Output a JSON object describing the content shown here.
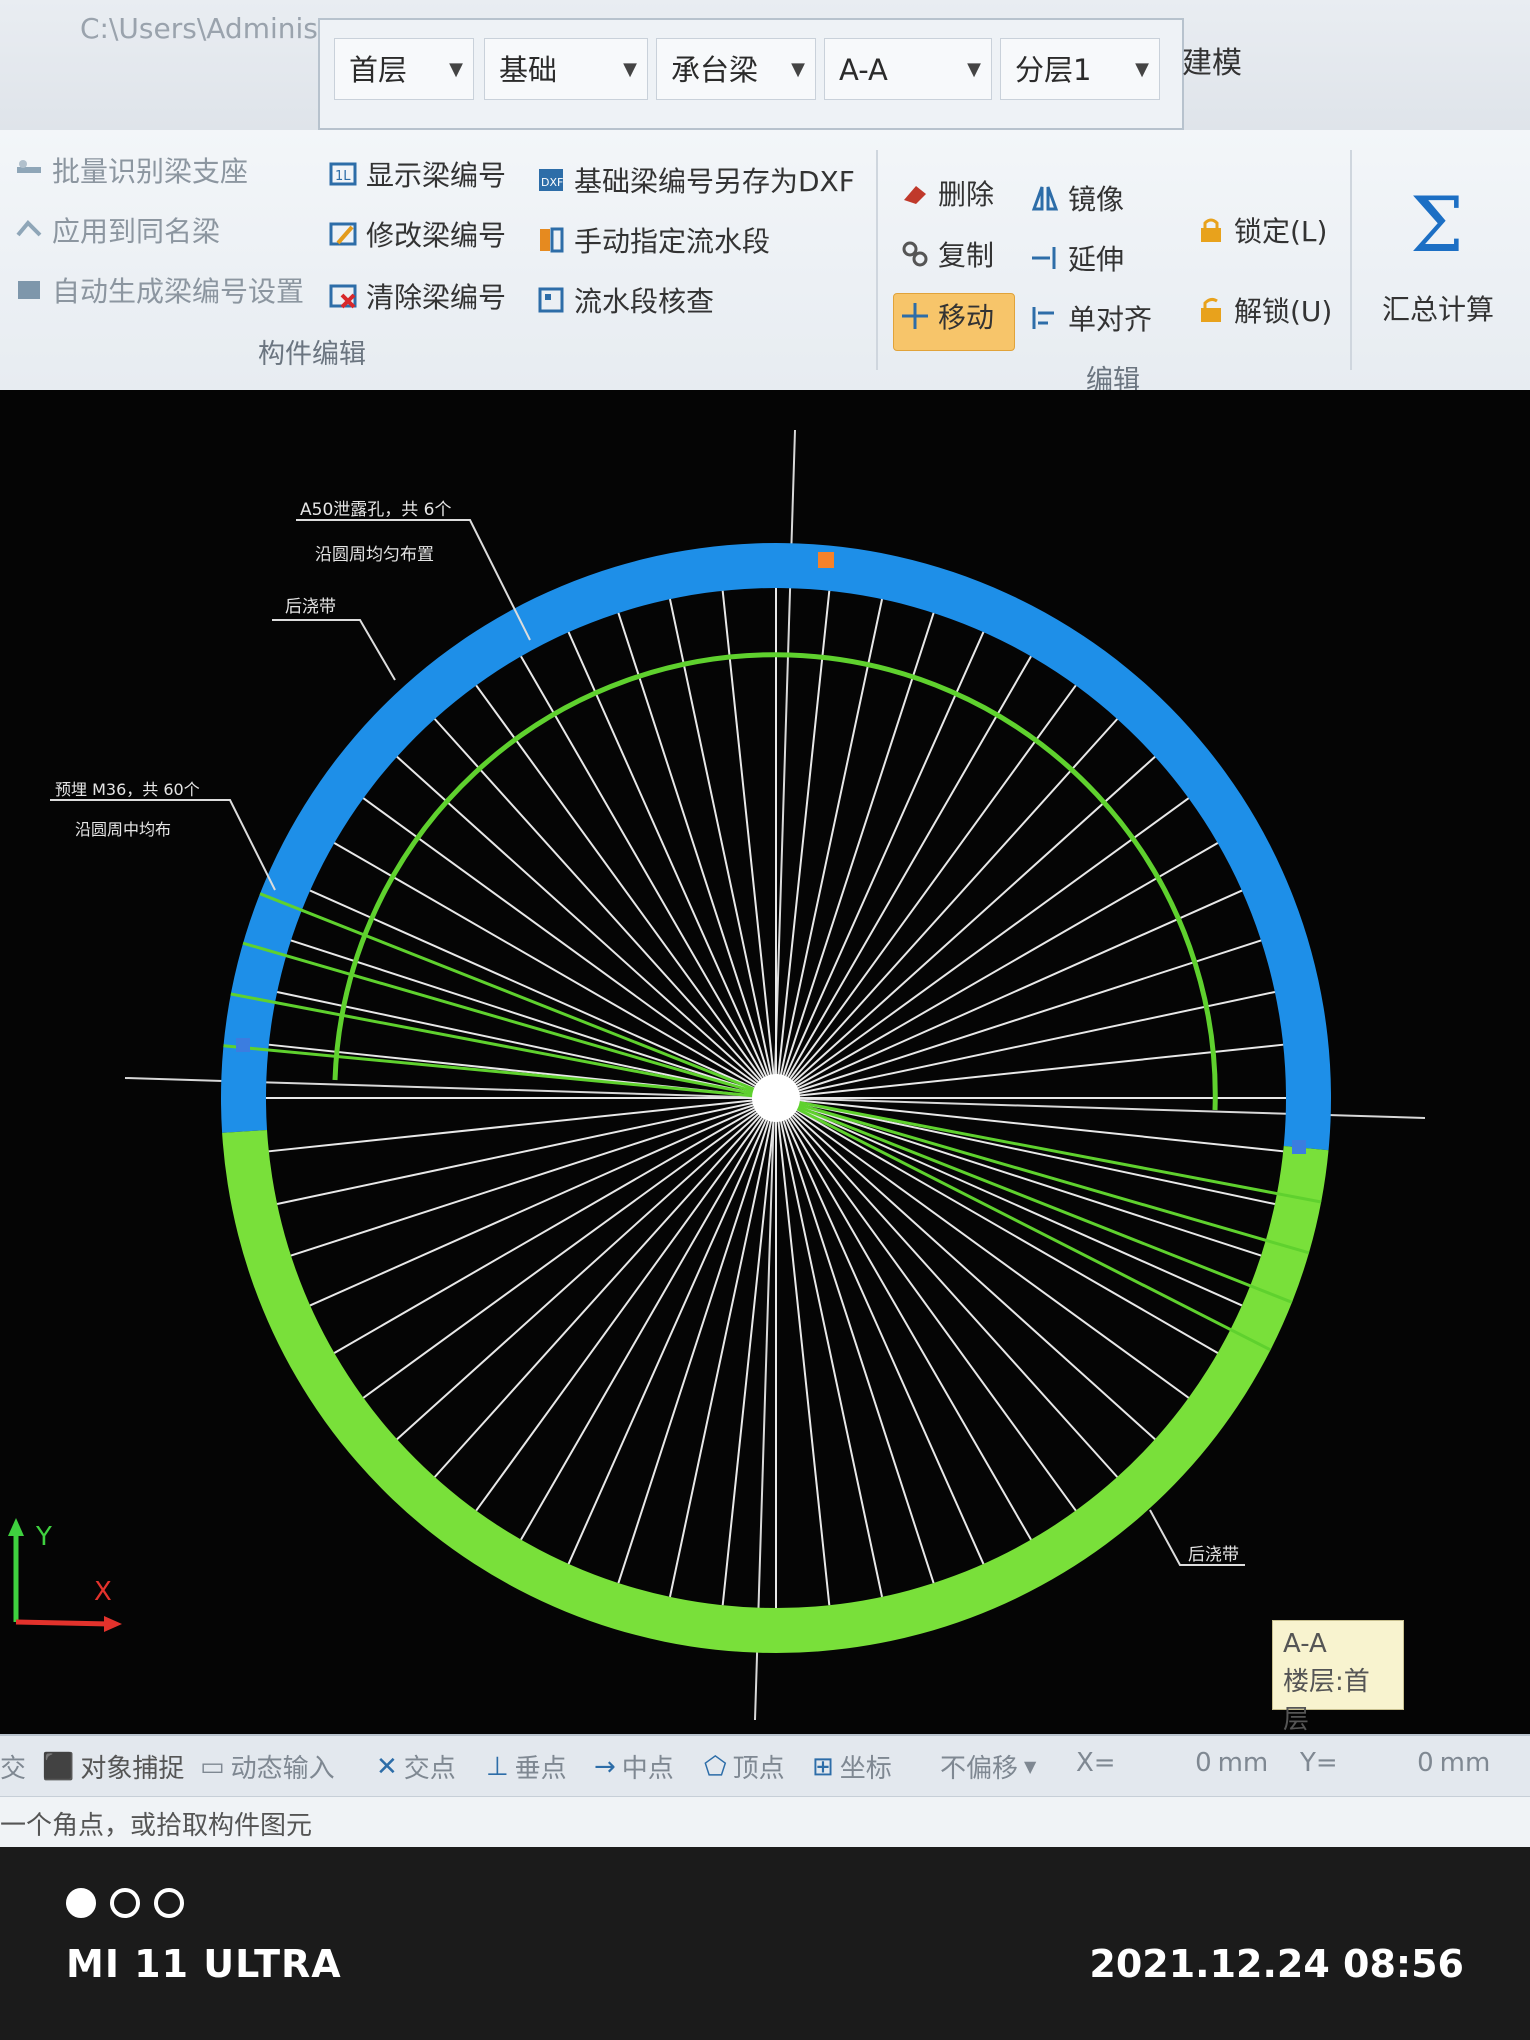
{
  "window": {
    "path": "C:\\Users\\Administ"
  },
  "selectors": [
    {
      "label": "首层"
    },
    {
      "label": "基础"
    },
    {
      "label": "承台梁"
    },
    {
      "label": "A-A"
    },
    {
      "label": "分层1"
    }
  ],
  "build_label": "建模",
  "ribbon": {
    "component_edit": {
      "group_label": "构件编辑",
      "items": [
        "批量识别梁支座",
        "应用到同名梁",
        "自动生成梁编号设置"
      ]
    },
    "beam_numbering": {
      "items": [
        "显示梁编号",
        "修改梁编号",
        "清除梁编号"
      ]
    },
    "flow": {
      "items": [
        "基础梁编号另存为DXF",
        "手动指定流水段",
        "流水段核查"
      ]
    },
    "edit": {
      "group_label": "编辑",
      "items": [
        "删除",
        "复制",
        "移动",
        "镜像",
        "延伸",
        "单对齐"
      ]
    },
    "lock": {
      "items": [
        "锁定(L)",
        "解锁(U)"
      ]
    },
    "calc": {
      "label": "汇总计算"
    }
  },
  "drawing": {
    "annotations": {
      "hole_note_1": "A50泄露孔，共 6个",
      "hole_note_2": "沿圆周均匀布置",
      "pour_strip_top": "后浇带",
      "bolt_note_1": "预埋 M36，共 60个",
      "bolt_note_2": "沿圆周中均布",
      "pour_strip_bottom": "后浇带"
    },
    "tooltip": {
      "line1": "A-A",
      "line2": "楼层:首层"
    },
    "axis": {
      "y": "Y",
      "x": "X"
    }
  },
  "statusbar": {
    "items": [
      "交",
      "对象捕捉",
      "动态输入",
      "交点",
      "垂点",
      "中点",
      "顶点",
      "坐标",
      "不偏移"
    ],
    "x_label": "X=",
    "x_value": "0",
    "x_unit": "mm",
    "y_label": "Y=",
    "y_value": "0",
    "y_unit": "mm"
  },
  "prompt": "一个角点，或拾取构件图元",
  "camera": {
    "brand": "MI 11 ULTRA",
    "timestamp": "2021.12.24 08:56"
  },
  "colors": {
    "ring_blue": "#1e8fe8",
    "ring_green": "#79e03a",
    "delete_highlight": "#f7c56a"
  }
}
